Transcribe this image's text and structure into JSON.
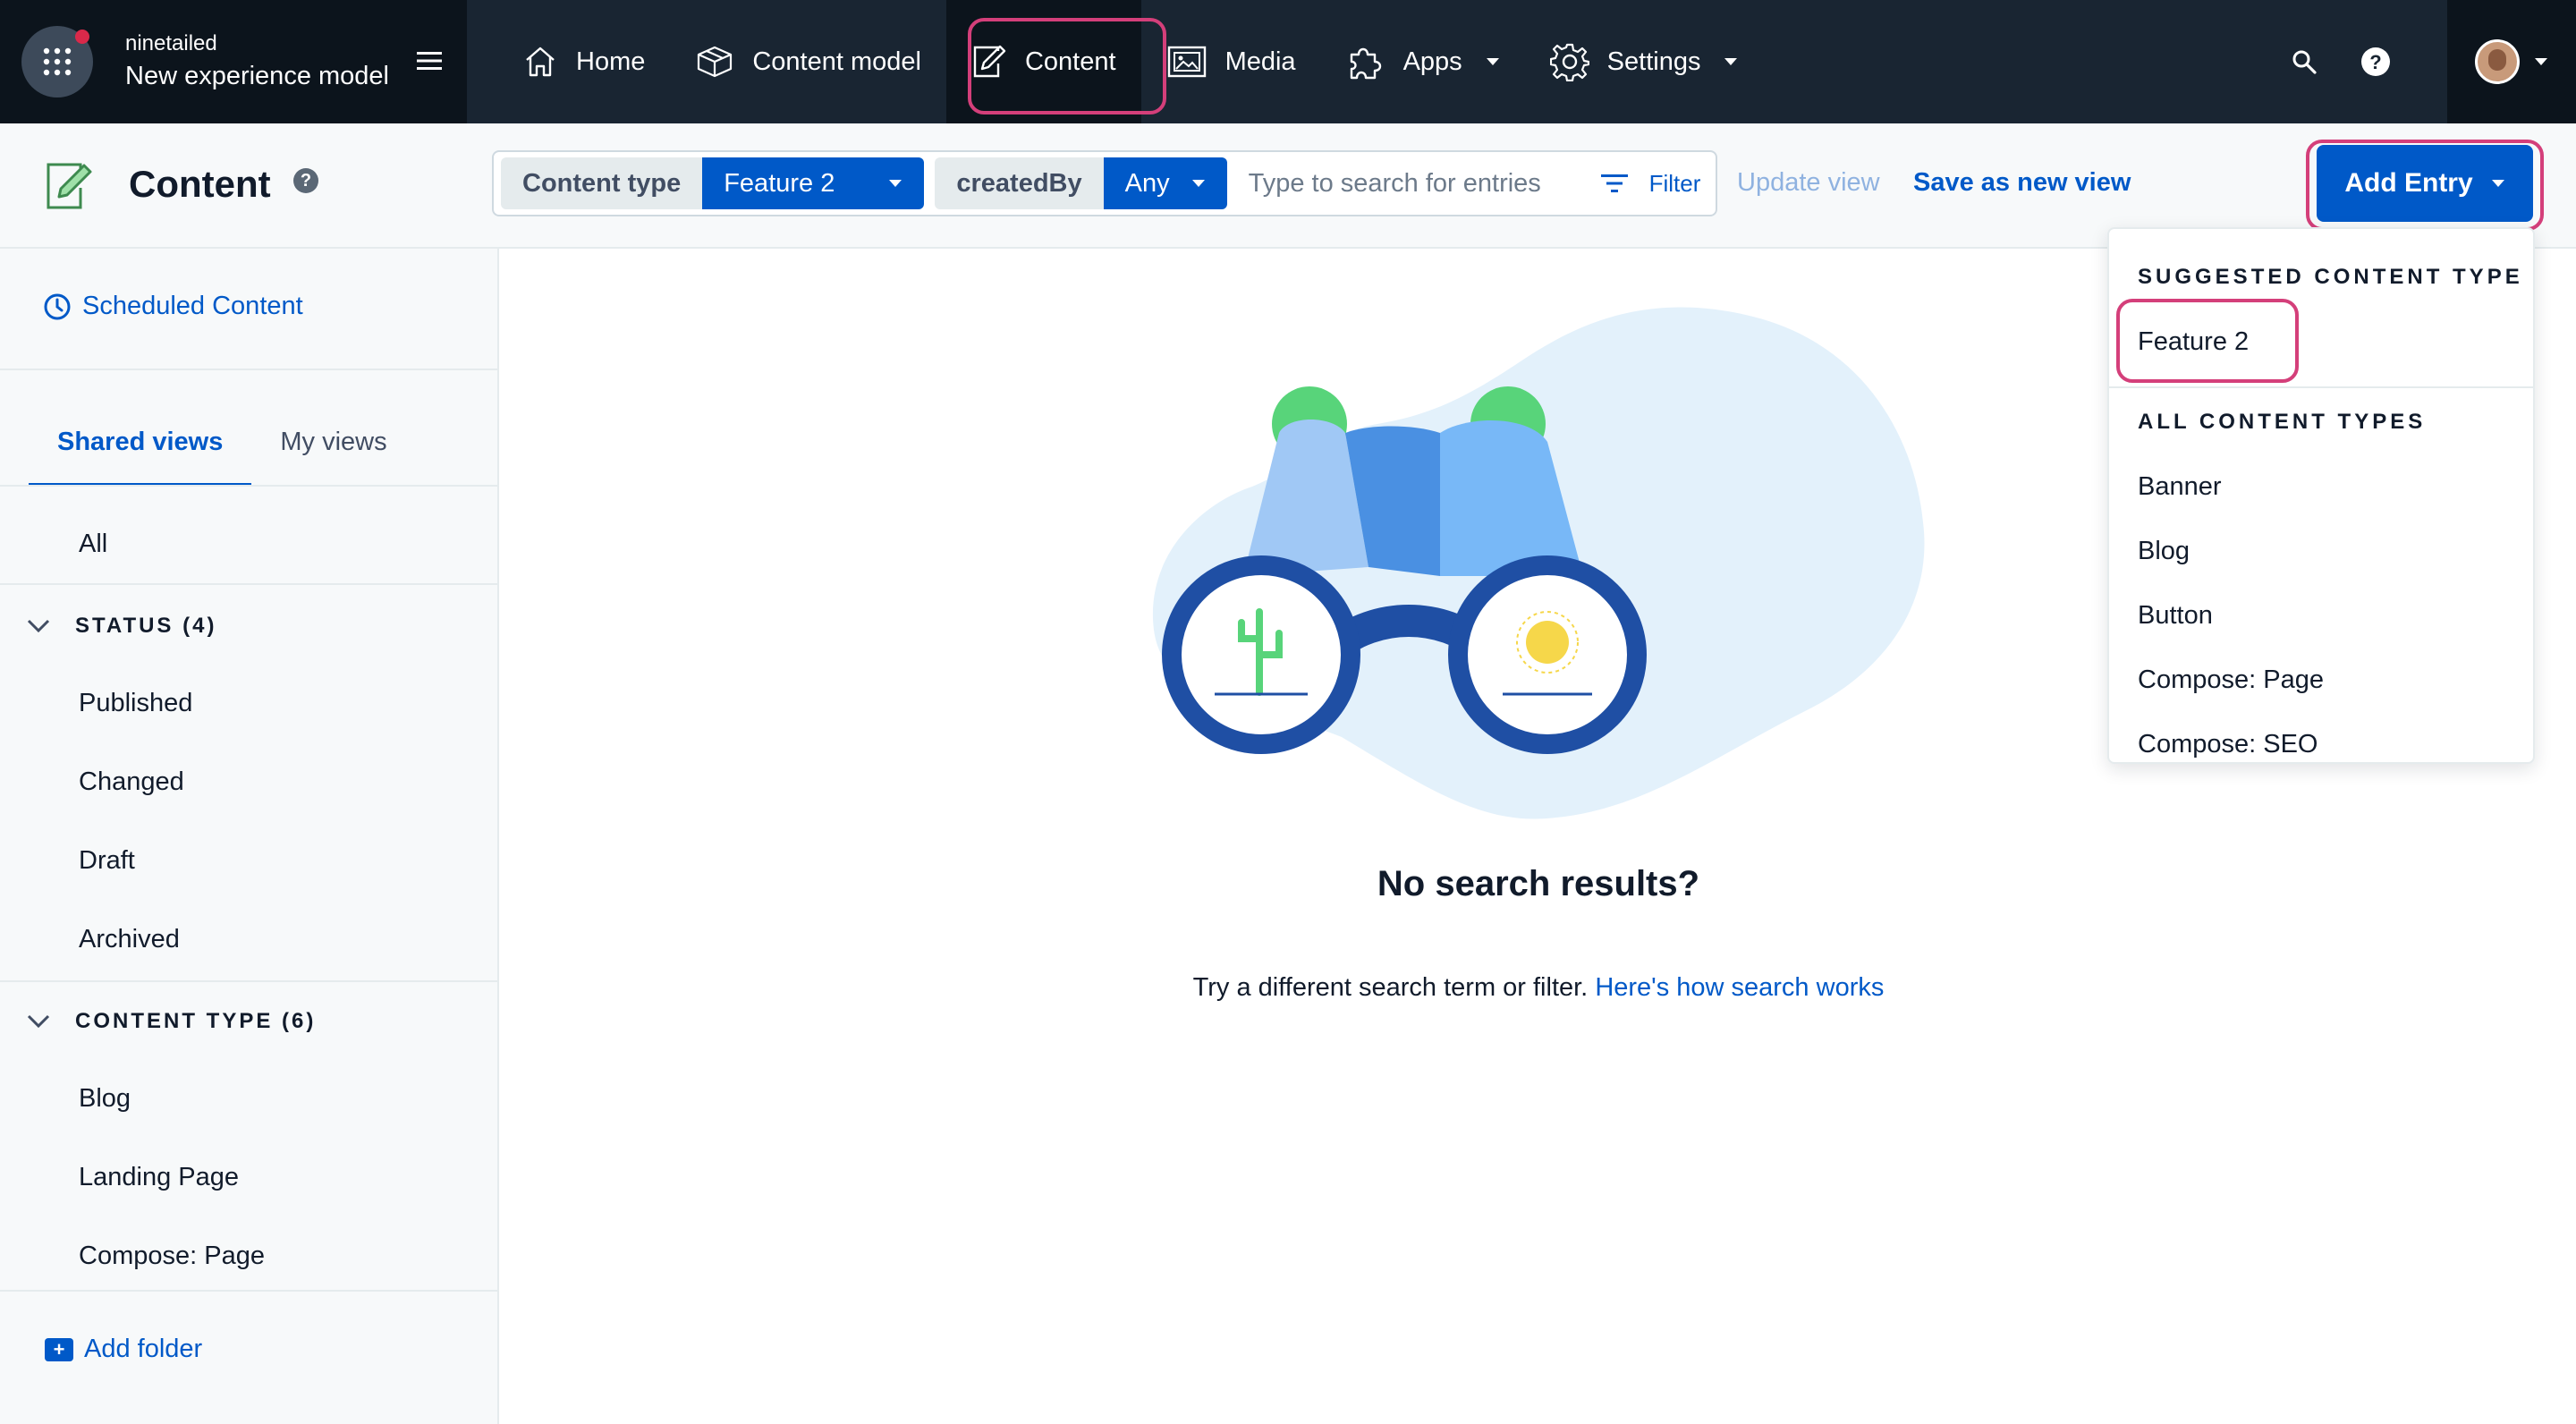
{
  "nav": {
    "org": "ninetailed",
    "environment": "New experience model",
    "items": [
      {
        "label": "Home"
      },
      {
        "label": "Content model"
      },
      {
        "label": "Content"
      },
      {
        "label": "Media"
      },
      {
        "label": "Apps"
      },
      {
        "label": "Settings"
      }
    ],
    "help_label": "?"
  },
  "header": {
    "title": "Content",
    "help_label": "?",
    "filters": {
      "content_type_label": "Content type",
      "content_type_value": "Feature 2",
      "created_by_label": "createdBy",
      "created_by_value": "Any",
      "search_placeholder": "Type to search for entries",
      "filter_label": "Filter"
    },
    "update_view": "Update view",
    "save_view": "Save as new view",
    "add_entry": "Add Entry"
  },
  "sidebar": {
    "scheduled": "Scheduled Content",
    "tabs": [
      "Shared views",
      "My views"
    ],
    "all": "All",
    "status_section": "STATUS (4)",
    "status_items": [
      "Published",
      "Changed",
      "Draft",
      "Archived"
    ],
    "content_type_section": "CONTENT TYPE (6)",
    "content_type_items": [
      "Blog",
      "Landing Page",
      "Compose: Page"
    ],
    "add_folder": "Add folder"
  },
  "main": {
    "empty_title": "No search results?",
    "empty_text": "Try a different search term or filter.",
    "empty_link": "Here's how search works"
  },
  "dropdown": {
    "suggested_heading": "SUGGESTED CONTENT TYPE",
    "suggested_item": "Feature 2",
    "all_heading": "ALL CONTENT TYPES",
    "items": [
      "Banner",
      "Blog",
      "Button",
      "Compose: Page",
      "Compose: SEO"
    ]
  },
  "colors": {
    "nav_bg": "#192532",
    "primary": "#0059c8",
    "highlight": "#d43f7a"
  }
}
